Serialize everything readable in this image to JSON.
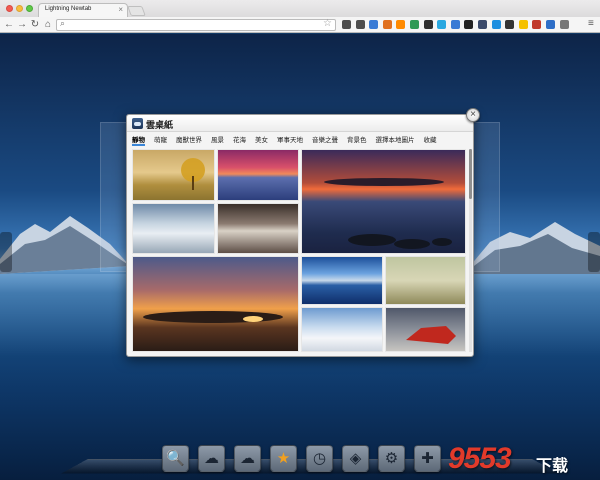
{
  "browser": {
    "tab_title": "Lightning Newtab",
    "tab_close": "×",
    "omnibox_value": "",
    "icons": {
      "back": "←",
      "forward": "→",
      "reload": "↻",
      "home": "⌂",
      "search": "⌕",
      "star": "☆",
      "menu": "≡"
    },
    "extension_colors": [
      "#4d4d4d",
      "#4d4d4d",
      "#3a7bd5",
      "#e0701f",
      "#ff8a00",
      "#2f9a55",
      "#2f2f2f",
      "#2aa8e0",
      "#3a7bd5",
      "#222222",
      "#3b4a6b",
      "#1e8fe0",
      "#333333",
      "#f5c100",
      "#c0392b",
      "#2d6ec7",
      "#777777"
    ]
  },
  "dialog": {
    "title": "雲桌紙",
    "close": "×",
    "tabs": [
      "靜物",
      "萌寵",
      "魔獸世界",
      "風景",
      "花海",
      "美女",
      "軍事天地",
      "音樂之聲",
      "背景色",
      "選擇本地圖片",
      "收藏"
    ],
    "active_tab": 0
  },
  "dock": {
    "items": [
      {
        "name": "search",
        "glyph": "🔍"
      },
      {
        "name": "cloud-wallpaper",
        "glyph": "☁"
      },
      {
        "name": "cloud",
        "glyph": "☁"
      },
      {
        "name": "favorite",
        "glyph": "★"
      },
      {
        "name": "history",
        "glyph": "◷"
      },
      {
        "name": "dropbox",
        "glyph": "◈"
      },
      {
        "name": "settings",
        "glyph": "⚙"
      },
      {
        "name": "add",
        "glyph": "✚"
      }
    ]
  },
  "watermark": {
    "main": "9553",
    "sub": "下载"
  }
}
